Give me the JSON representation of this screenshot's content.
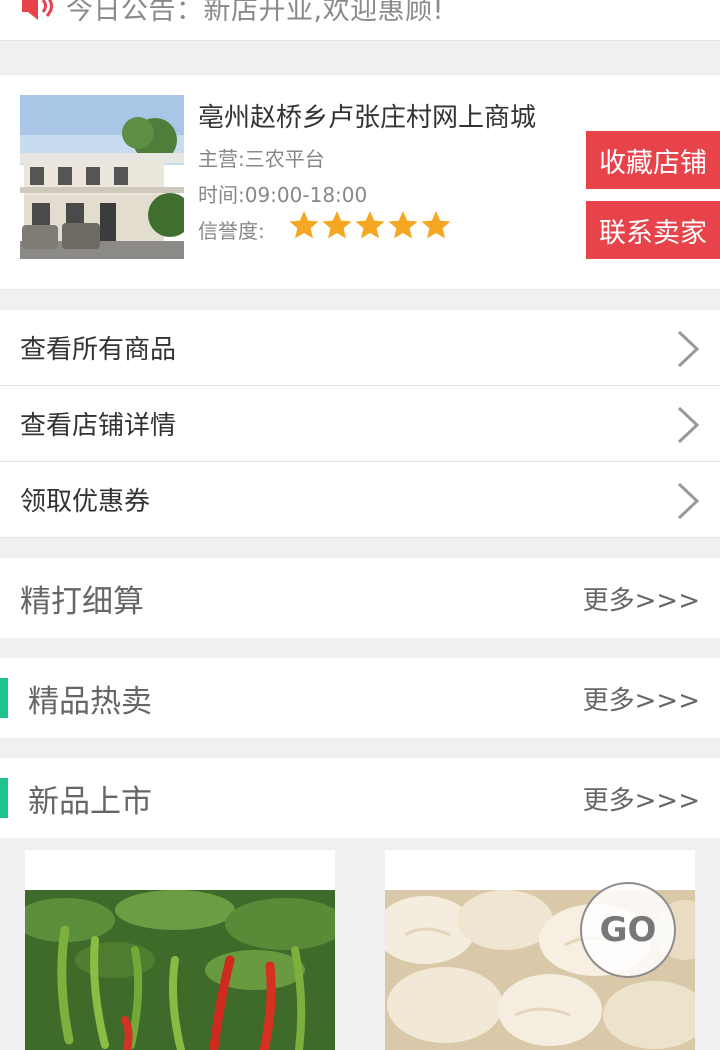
{
  "notice": {
    "text": "今日公告：新店开业,欢迎惠顾!",
    "icon": "speaker-icon"
  },
  "shop": {
    "name": "亳州赵桥乡卢张庄村网上商城",
    "business": "主营:三农平台",
    "hours": "时间:09:00-18:00",
    "credit_label": "信誉度:",
    "rating": 5,
    "favorite_label": "收藏店铺",
    "contact_label": "联系卖家",
    "accent_color": "#e8424a",
    "star_color": "#f5a623"
  },
  "menu": [
    {
      "label": "查看所有商品"
    },
    {
      "label": "查看店铺详情"
    },
    {
      "label": "领取优惠券"
    }
  ],
  "sections": [
    {
      "title": "精打细算",
      "more": "更多>>>"
    },
    {
      "title": "精品热卖",
      "more": "更多>>>"
    },
    {
      "title": "新品上市",
      "more": "更多>>>"
    }
  ],
  "go_button": {
    "label": "GO"
  },
  "section_bar_color": "#1dc58a"
}
